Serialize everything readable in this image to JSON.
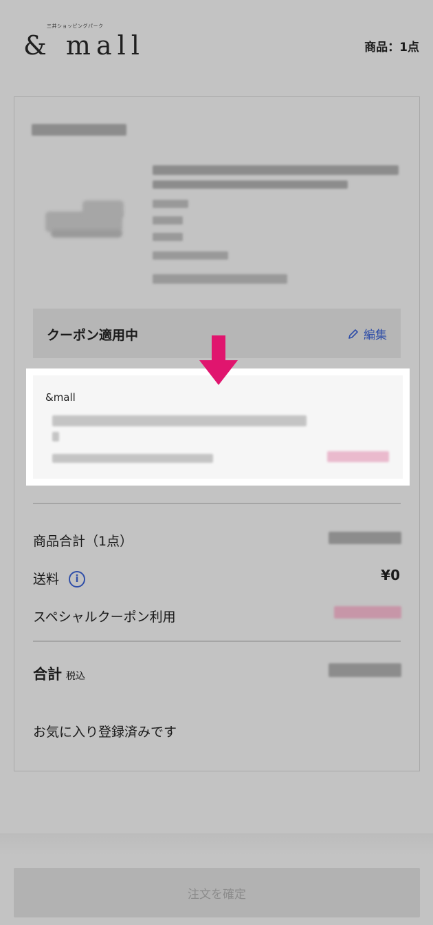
{
  "header": {
    "logo_sub": "三井ショッピングパーク",
    "logo": "& mall",
    "item_count": "商品：1点"
  },
  "coupon": {
    "applied_label": "クーポン適用中",
    "edit_label": "編集",
    "shop_name": "&mall"
  },
  "summary": {
    "subtotal_label": "商品合計（1点）",
    "shipping_label": "送料",
    "shipping_info_glyph": "i",
    "shipping_value": "¥0",
    "special_coupon_label": "スペシャルクーポン利用",
    "total_label": "合計",
    "tax_label": "税込"
  },
  "favorite_note": "お気に入り登録済みです",
  "footer": {
    "confirm_label": "注文を確定"
  },
  "colors": {
    "accent_arrow": "#e0156e",
    "link_blue": "#2f4ea8",
    "discount_pink": "#c9879f"
  },
  "icons": [
    "pencil-icon",
    "info-icon",
    "down-arrow-icon"
  ]
}
